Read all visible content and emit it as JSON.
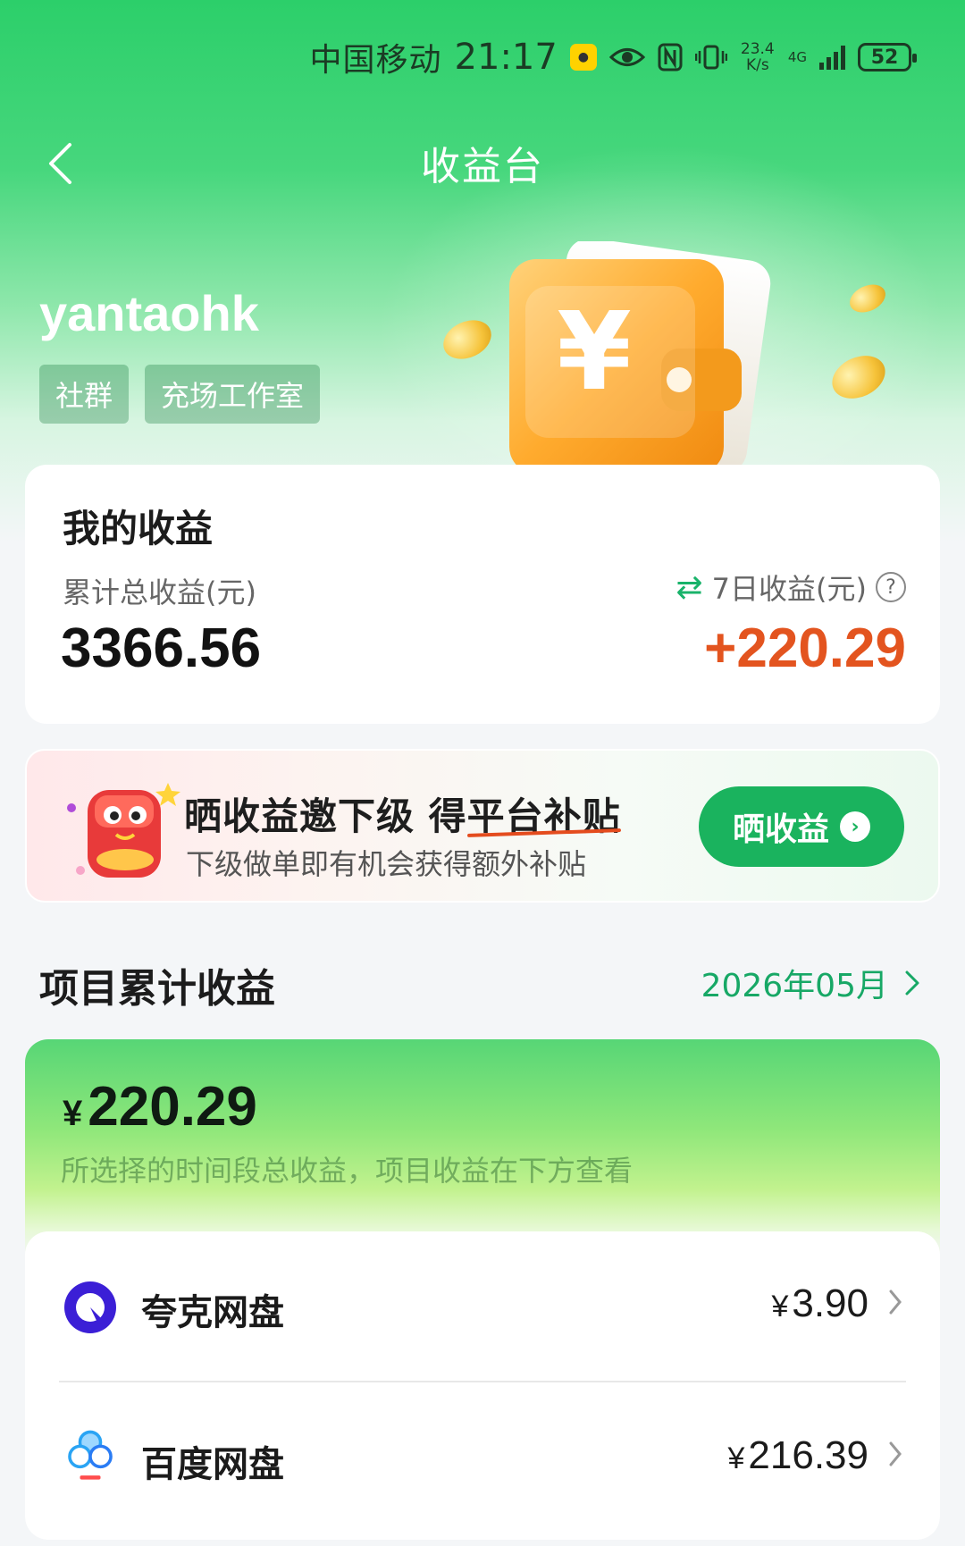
{
  "status_bar": {
    "carrier": "中国移动",
    "time": "21:17",
    "net_speed_value": "23.4",
    "net_speed_unit": "K/s",
    "network_type": "4G",
    "battery": "52"
  },
  "header": {
    "title": "收益台"
  },
  "profile": {
    "username": "yantaohk",
    "tags": [
      "社群",
      "充场工作室"
    ]
  },
  "my_earnings": {
    "title": "我的收益",
    "total_label": "累计总收益(元)",
    "total_value": "3366.56",
    "seven_day_label": "7日收益(元)",
    "seven_day_value": "+220.29"
  },
  "promo": {
    "title_prefix": "晒收益邀下级 得",
    "title_highlight": "平台补贴",
    "subtitle": "下级做单即有机会获得额外补贴",
    "button_label": "晒收益"
  },
  "projects": {
    "title": "项目累计收益",
    "period": "2026年05月",
    "currency_symbol": "¥",
    "total_value": "220.29",
    "total_desc": "所选择的时间段总收益，项目收益在下方查看",
    "items": [
      {
        "name": "夸克网盘",
        "amount": "3.90",
        "icon": "quark-logo-icon"
      },
      {
        "name": "百度网盘",
        "amount": "216.39",
        "icon": "baidu-netdisk-logo-icon"
      }
    ]
  },
  "colors": {
    "brand_green": "#1ab35e",
    "accent_orange": "#e3541f",
    "link_green": "#17a866"
  }
}
